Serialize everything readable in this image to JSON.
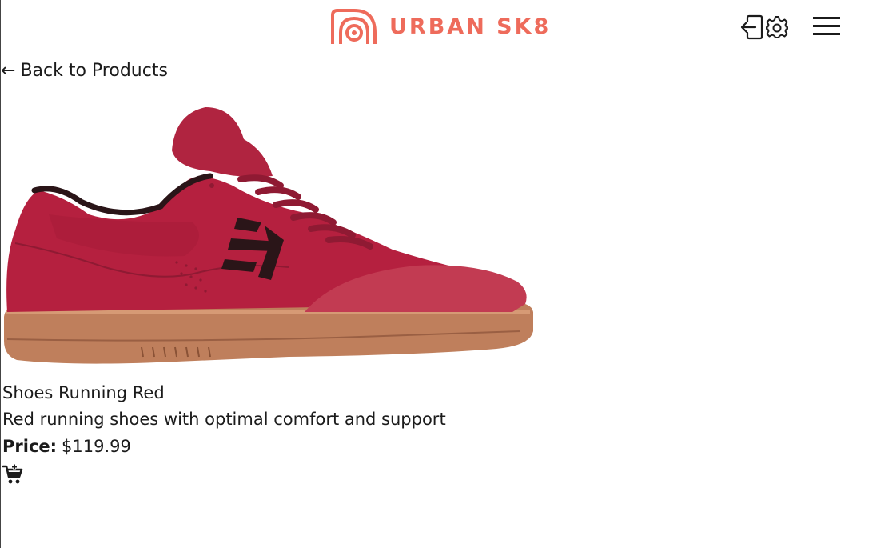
{
  "brand": {
    "name": "URBAN SK8",
    "logo_icon": "urban-sk8-logo",
    "accent_color": "#ee6b5b"
  },
  "header": {
    "icons": [
      "login-icon",
      "settings-icon",
      "hamburger-menu-icon"
    ]
  },
  "nav": {
    "back_arrow": "←",
    "back_label": "Back to Products"
  },
  "product": {
    "image_icon": "red-skate-shoe-image",
    "name": "Shoes Running Red",
    "description": "Red running shoes with optimal comfort and support",
    "price_label": "Price:",
    "price_value": "$119.99",
    "cart_icon": "add-to-cart-icon"
  }
}
